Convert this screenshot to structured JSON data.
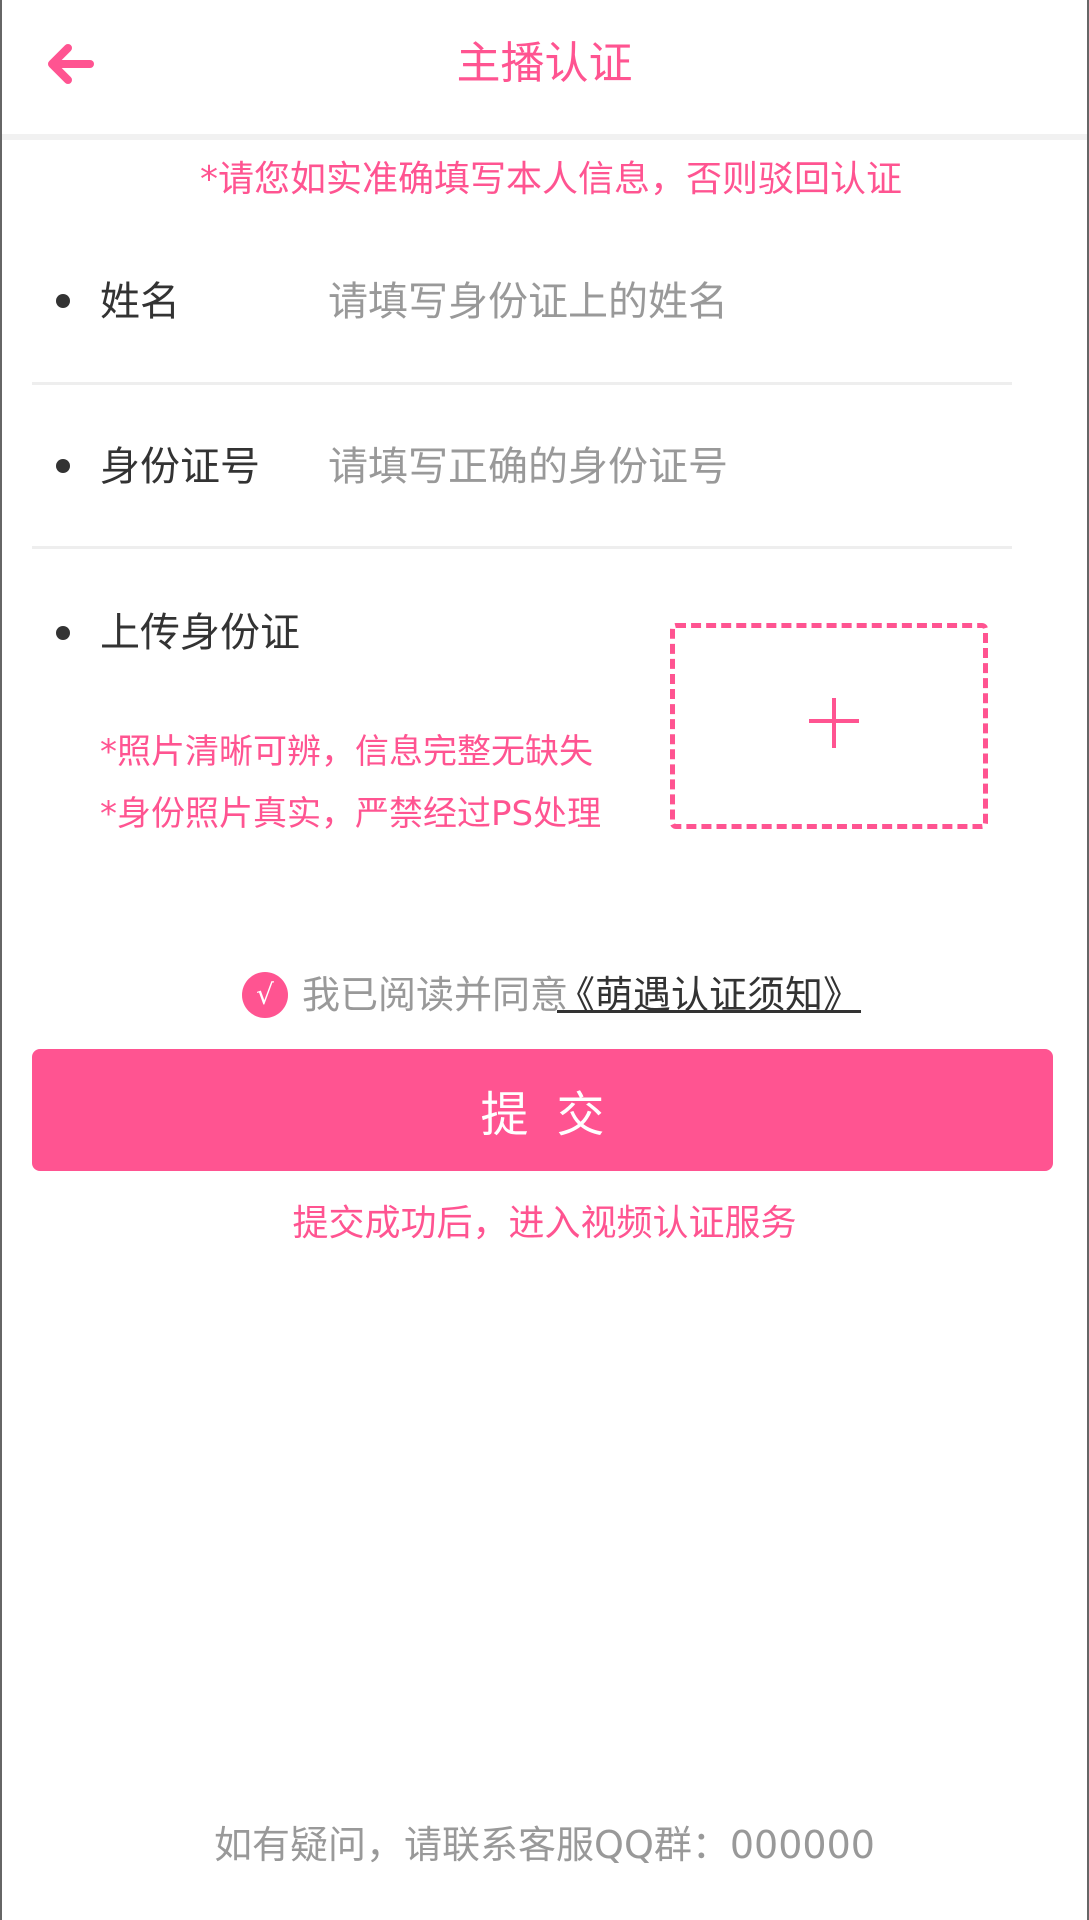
{
  "colors": {
    "accent": "#ff5491",
    "primary_text": "#333333",
    "hint_text": "#999999",
    "button_text": "#ffffff"
  },
  "header": {
    "title": "主播认证",
    "back_icon": "arrow-left-icon"
  },
  "notice": "*请您如实准确填写本人信息，否则驳回认证",
  "form": {
    "name": {
      "label": "姓名",
      "placeholder": "请填写身份证上的姓名",
      "value": ""
    },
    "id_number": {
      "label": "身份证号",
      "placeholder": "请填写正确的身份证号",
      "value": ""
    },
    "upload": {
      "label": "上传身份证",
      "icon": "plus-icon"
    }
  },
  "tips": [
    "*照片清晰可辨，信息完整无缺失",
    "*身份照片真实，严禁经过PS处理"
  ],
  "agreement": {
    "check_glyph": "√",
    "text": "我已阅读并同意",
    "link": "《萌遇认证须知》",
    "checked": true
  },
  "submit_label": "提交",
  "after_submit": "提交成功后，进入视频认证服务",
  "footer": "如有疑问，请联系客服QQ群：000000"
}
